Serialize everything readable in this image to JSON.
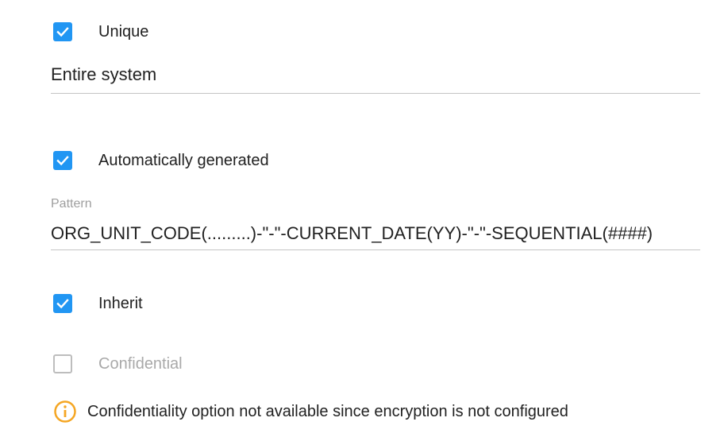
{
  "unique": {
    "label": "Unique",
    "checked": true
  },
  "scope": {
    "value": "Entire system"
  },
  "auto_generated": {
    "label": "Automatically generated",
    "checked": true
  },
  "pattern": {
    "label": "Pattern",
    "value": "ORG_UNIT_CODE(.........)-\"-\"-CURRENT_DATE(YY)-\"-\"-SEQUENTIAL(####)"
  },
  "inherit": {
    "label": "Inherit",
    "checked": true
  },
  "confidential": {
    "label": "Confidential",
    "checked": false,
    "disabled": true
  },
  "notice": {
    "icon": "info-icon",
    "text": "Confidentiality option not available since encryption is not configured",
    "icon_color": "#f5a623"
  },
  "colors": {
    "accent": "#2196f3",
    "warning": "#f5a623"
  }
}
